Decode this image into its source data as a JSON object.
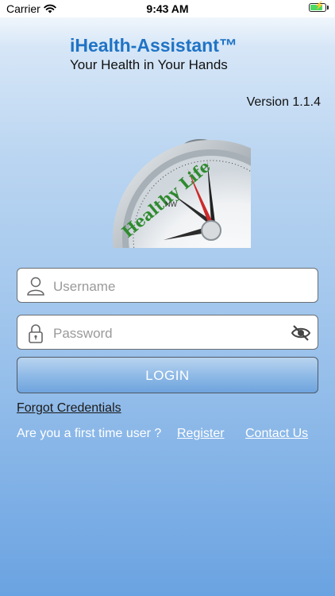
{
  "status_bar": {
    "carrier": "Carrier",
    "time": "9:43 AM"
  },
  "brand": {
    "title": "iHealth-Assistant™",
    "subtitle": "Your Health in Your Hands"
  },
  "version": "Version 1.1.4",
  "compass": {
    "label": "Healthy Life",
    "direction_label": "NW"
  },
  "username": {
    "placeholder": "Username",
    "value": ""
  },
  "password": {
    "placeholder": "Password",
    "value": ""
  },
  "login_label": "LOGIN",
  "links": {
    "forgot": "Forgot Credentials",
    "first_time": "Are you a first time user ?",
    "register": "Register",
    "contact": "Contact Us"
  },
  "colors": {
    "brand_blue": "#1f73c5",
    "battery_green": "#4cd964"
  }
}
